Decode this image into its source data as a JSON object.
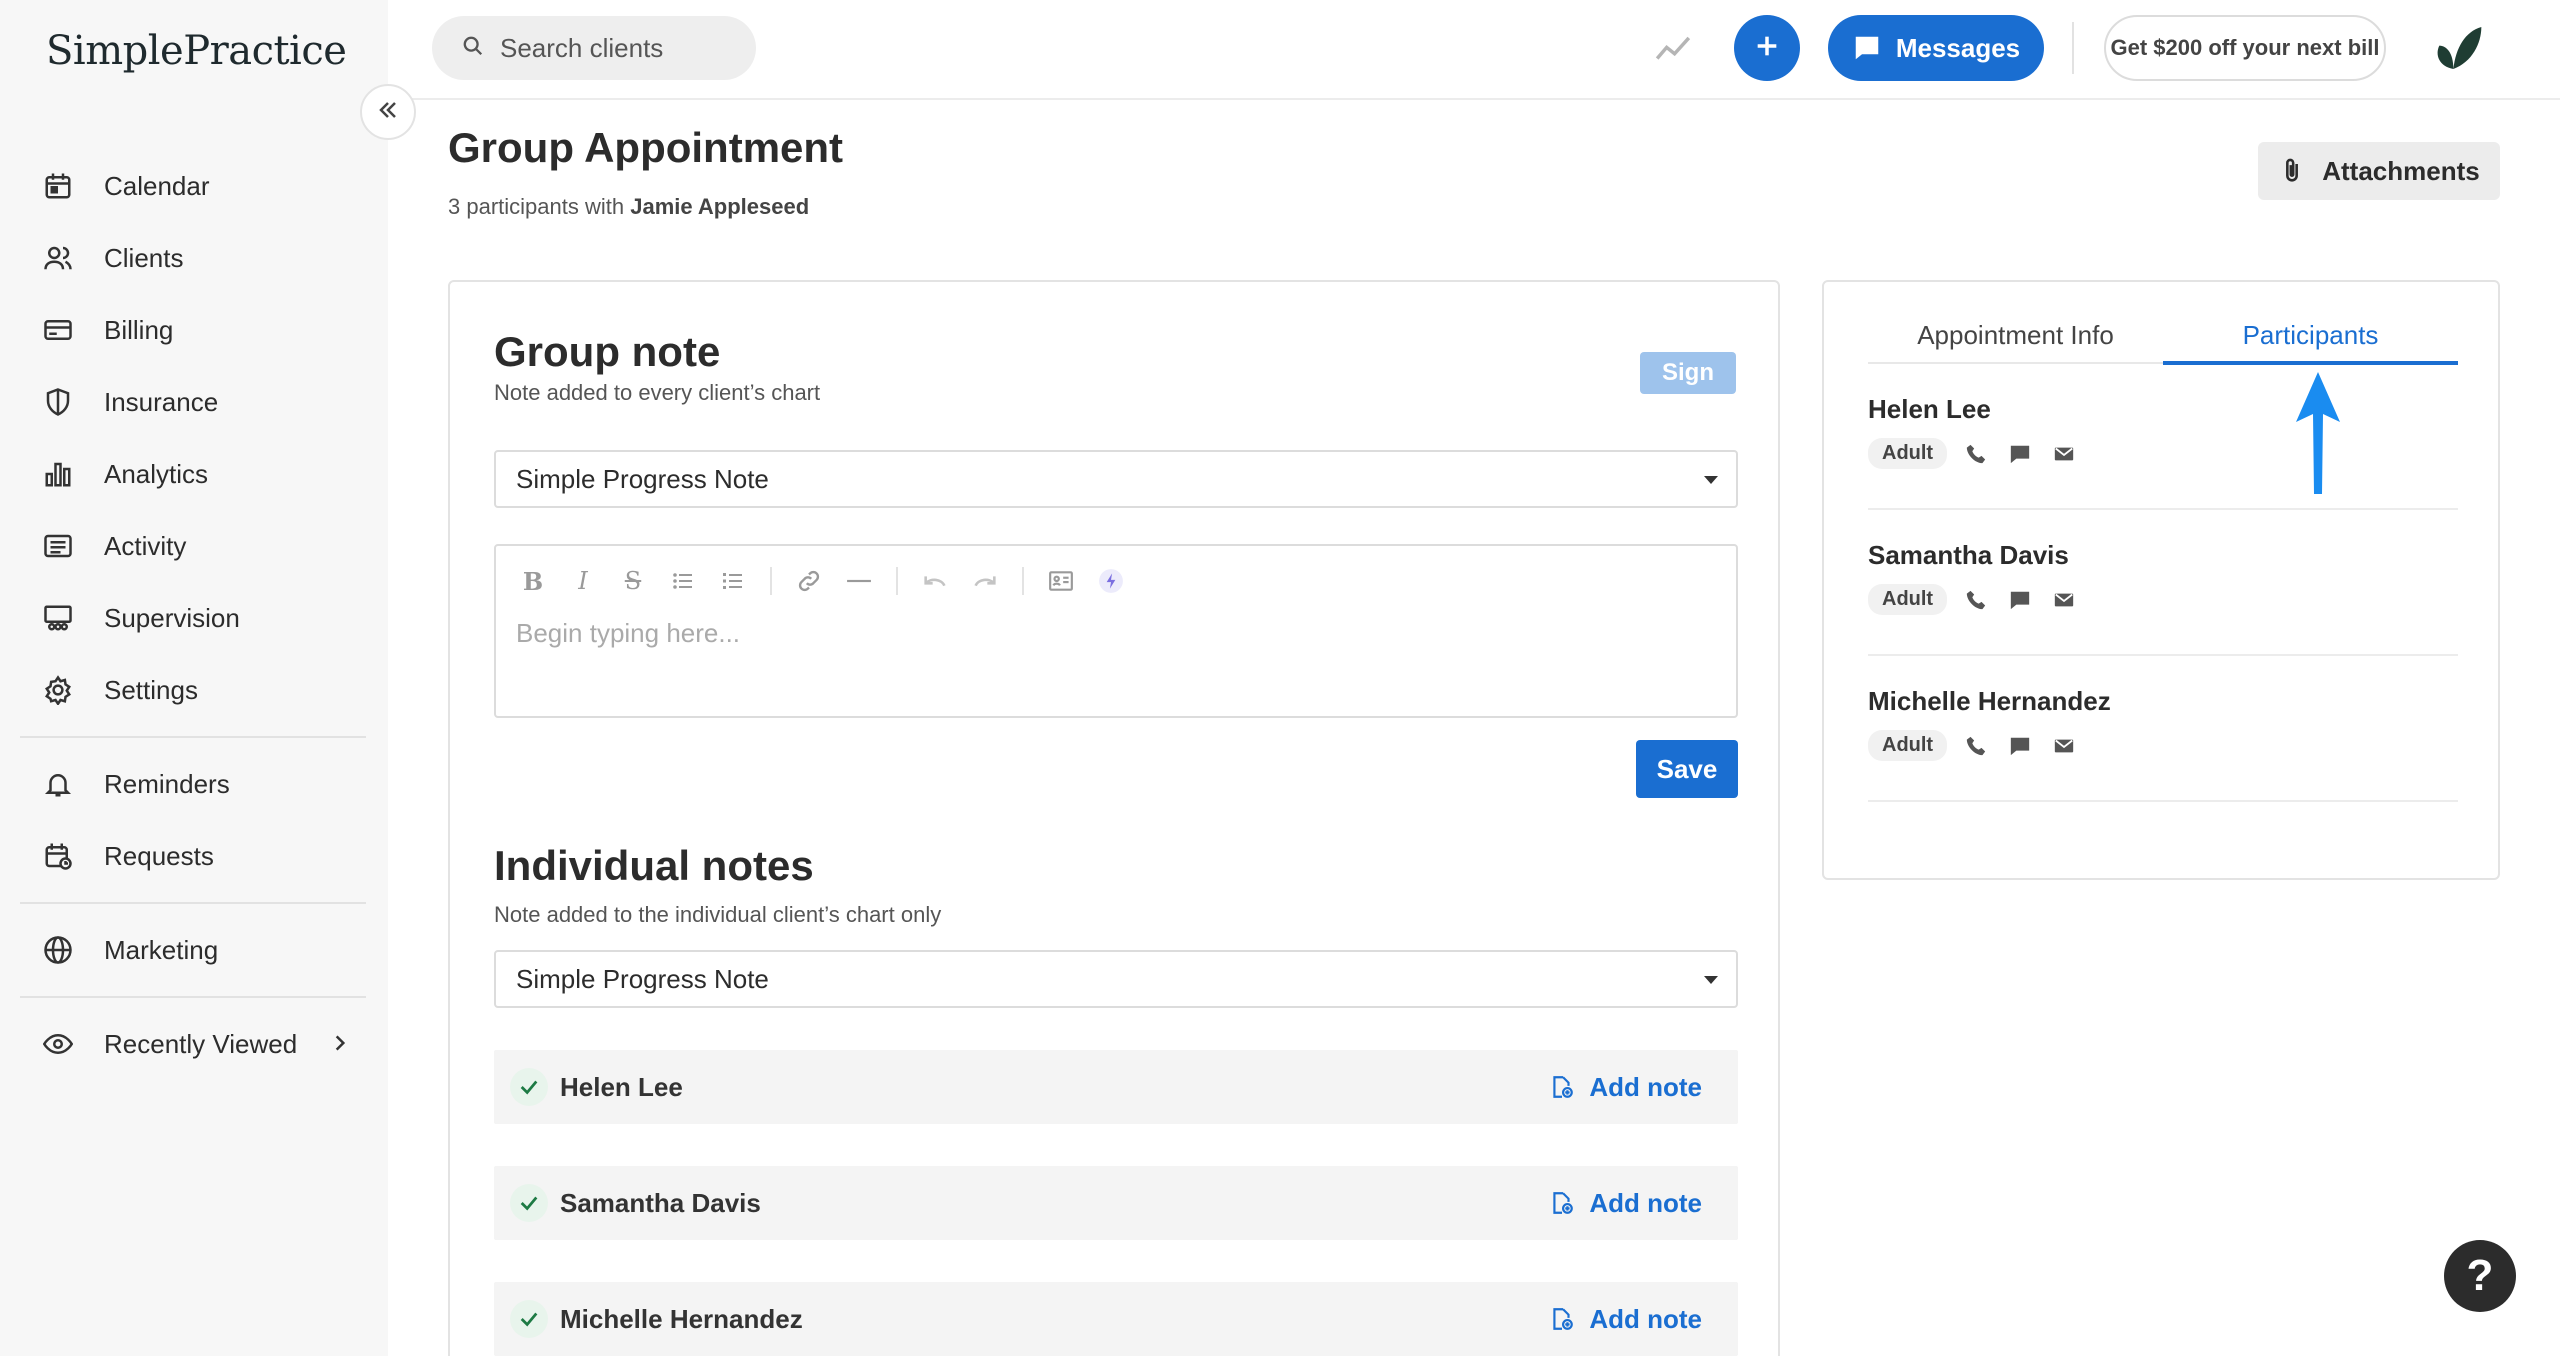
{
  "app": {
    "logo_text": "SimplePractice"
  },
  "sidebar": {
    "items": [
      {
        "label": "Calendar",
        "icon": "calendar-icon"
      },
      {
        "label": "Clients",
        "icon": "clients-icon"
      },
      {
        "label": "Billing",
        "icon": "credit-card-icon"
      },
      {
        "label": "Insurance",
        "icon": "shield-icon"
      },
      {
        "label": "Analytics",
        "icon": "bar-chart-icon"
      },
      {
        "label": "Activity",
        "icon": "list-icon"
      },
      {
        "label": "Supervision",
        "icon": "supervision-icon"
      },
      {
        "label": "Settings",
        "icon": "gear-icon"
      }
    ],
    "items2": [
      {
        "label": "Reminders",
        "icon": "bell-icon"
      },
      {
        "label": "Requests",
        "icon": "calendar-clock-icon"
      }
    ],
    "items3": [
      {
        "label": "Marketing",
        "icon": "globe-icon"
      }
    ],
    "recently_viewed": {
      "label": "Recently Viewed",
      "icon": "eye-icon"
    }
  },
  "topbar": {
    "search_placeholder": "Search clients",
    "messages_label": "Messages",
    "promo_label": "Get $200 off your next bill"
  },
  "page": {
    "title": "Group Appointment",
    "subtitle_prefix": "3 participants with",
    "clinician": "Jamie Appleseed",
    "attachments_label": "Attachments"
  },
  "group_note": {
    "title": "Group note",
    "subtitle": "Note added to every client’s chart",
    "sign_label": "Sign",
    "template": "Simple Progress Note",
    "editor_placeholder": "Begin typing here...",
    "save_label": "Save"
  },
  "individual_notes": {
    "title": "Individual notes",
    "subtitle": "Note added to the individual client’s chart only",
    "template": "Simple Progress Note",
    "add_note_label": "Add note",
    "clients": [
      "Helen Lee",
      "Samantha Davis",
      "Michelle Hernandez"
    ]
  },
  "right_panel": {
    "tabs": [
      "Appointment Info",
      "Participants"
    ],
    "active_tab": "Participants",
    "participants": [
      {
        "name": "Helen Lee",
        "badge": "Adult"
      },
      {
        "name": "Samantha Davis",
        "badge": "Adult"
      },
      {
        "name": "Michelle Hernandez",
        "badge": "Adult"
      }
    ]
  },
  "colors": {
    "accent": "#1a6ed1",
    "annotation_arrow": "#1a8cf0",
    "sign_disabled": "#9ec3ec"
  },
  "help_label": "?"
}
